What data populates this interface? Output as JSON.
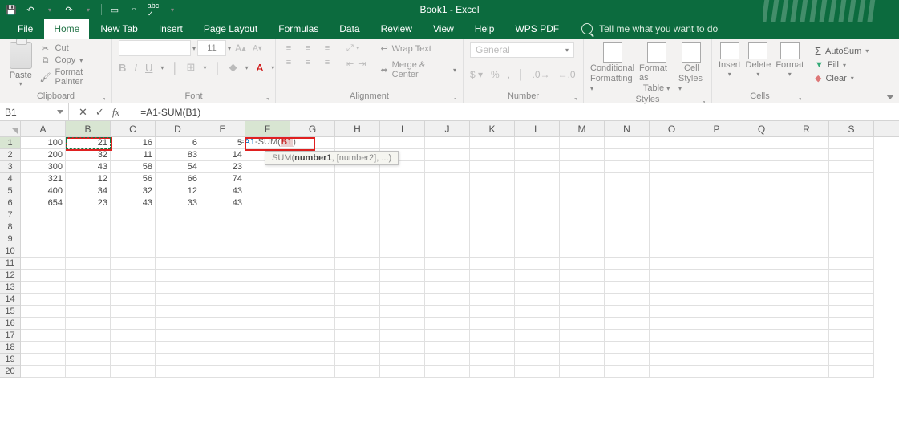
{
  "window_title": "Book1 - Excel",
  "qat": {
    "save": "💾",
    "undo": "↶",
    "redo": "↷"
  },
  "menu": {
    "file": "File",
    "home": "Home",
    "newtab": "New Tab",
    "insert": "Insert",
    "pagelayout": "Page Layout",
    "formulas": "Formulas",
    "data": "Data",
    "review": "Review",
    "view": "View",
    "help": "Help",
    "wpspdf": "WPS PDF",
    "tellme": "Tell me what you want to do"
  },
  "ribbon": {
    "clipboard": {
      "paste": "Paste",
      "cut": "Cut",
      "copy": "Copy",
      "format_painter": "Format Painter",
      "label": "Clipboard"
    },
    "font": {
      "size": "11",
      "bold": "B",
      "italic": "I",
      "underline": "U",
      "increase": "A",
      "decrease": "A",
      "label": "Font"
    },
    "alignment": {
      "wrap": "Wrap Text",
      "merge": "Merge & Center",
      "label": "Alignment"
    },
    "number": {
      "general": "General",
      "label": "Number"
    },
    "styles": {
      "cond": "Conditional",
      "cond2": "Formatting",
      "fmt": "Format as",
      "fmt2": "Table",
      "cell": "Cell",
      "cell2": "Styles",
      "label": "Styles"
    },
    "cells": {
      "insert": "Insert",
      "delete": "Delete",
      "format": "Format",
      "label": "Cells"
    },
    "editing": {
      "autosum": "AutoSum",
      "fill": "Fill",
      "clear": "Clear"
    }
  },
  "namebox": "B1",
  "formula_bar": "=A1-SUM(B1)",
  "columns": [
    "A",
    "B",
    "C",
    "D",
    "E",
    "F",
    "G",
    "H",
    "I",
    "J",
    "K",
    "L",
    "M",
    "N",
    "O",
    "P",
    "Q",
    "R",
    "S"
  ],
  "rows": [
    "1",
    "2",
    "3",
    "4",
    "5",
    "6",
    "7",
    "8",
    "9",
    "10",
    "11",
    "12",
    "13",
    "14",
    "15",
    "16",
    "17",
    "18",
    "19",
    "20"
  ],
  "chart_data": {
    "type": "table",
    "columns": [
      "A",
      "B",
      "C",
      "D",
      "E"
    ],
    "rows": [
      [
        100,
        21,
        16,
        6,
        5
      ],
      [
        200,
        32,
        11,
        83,
        14
      ],
      [
        300,
        43,
        58,
        54,
        23
      ],
      [
        321,
        12,
        56,
        66,
        74
      ],
      [
        400,
        34,
        32,
        12,
        43
      ],
      [
        654,
        23,
        43,
        33,
        43
      ]
    ]
  },
  "f1_formula": {
    "prefix": "=",
    "ref1": "A1",
    "mid": "-SUM(",
    "ref2": "B1",
    "suffix": ")"
  },
  "fn_tooltip": {
    "name": "SUM(",
    "arg1": "number1",
    "rest": ", [number2], ...)"
  },
  "editing_sigma": "Σ",
  "cut_icon": "✂",
  "check_icon": "✓",
  "x_icon": "✕",
  "clear_icon": "◆"
}
